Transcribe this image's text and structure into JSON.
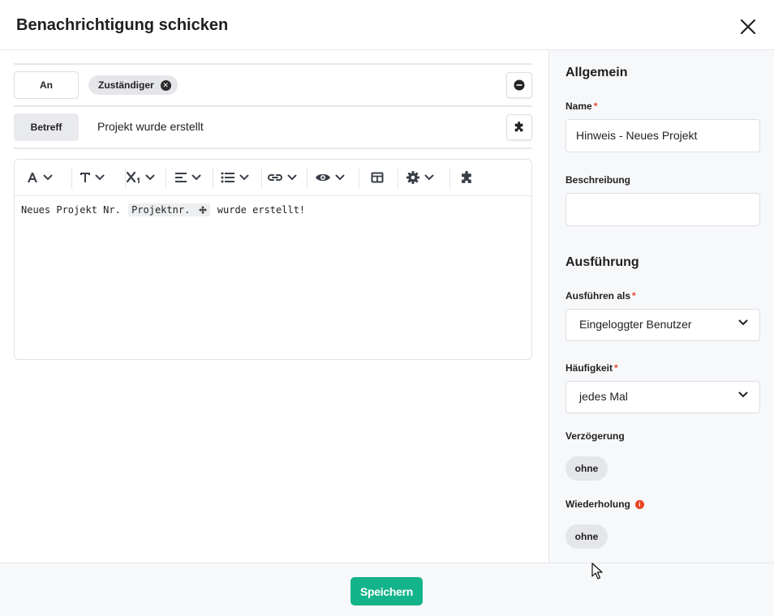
{
  "dialog": {
    "title": "Benachrichtigung schicken"
  },
  "recipients": {
    "label": "An",
    "tags": [
      {
        "label": "Zuständiger"
      }
    ]
  },
  "subject": {
    "label": "Betreff",
    "value": "Projekt wurde erstellt"
  },
  "editor": {
    "text_before": "Neues Projekt Nr.",
    "placeholder": "Projektnr.",
    "text_after": "wurde erstellt!"
  },
  "sidebar": {
    "general_title": "Allgemein",
    "name_label": "Name",
    "name_value": "Hinweis - Neues Projekt",
    "description_label": "Beschreibung",
    "description_value": "",
    "execution_title": "Ausführung",
    "run_as_label": "Ausführen als",
    "run_as_value": "Eingeloggter Benutzer",
    "frequency_label": "Häufigkeit",
    "frequency_value": "jedes Mal",
    "delay_label": "Verzögerung",
    "delay_value": "ohne",
    "repeat_label": "Wiederholung",
    "repeat_value": "ohne",
    "required_marker": "*"
  },
  "footer": {
    "save_label": "Speichern"
  },
  "colors": {
    "accent": "#14b48b",
    "required": "#e2492b",
    "panel": "#f7f8fa"
  },
  "icons": [
    "close-icon",
    "add-circle-icon",
    "puzzle-icon",
    "font-color-icon",
    "text-format-icon",
    "subscript-icon",
    "align-icon",
    "list-icon",
    "link-icon",
    "preview-icon",
    "table-icon",
    "settings-icon",
    "chevron-down-icon",
    "move-icon",
    "info-icon",
    "remove-tag-icon"
  ]
}
